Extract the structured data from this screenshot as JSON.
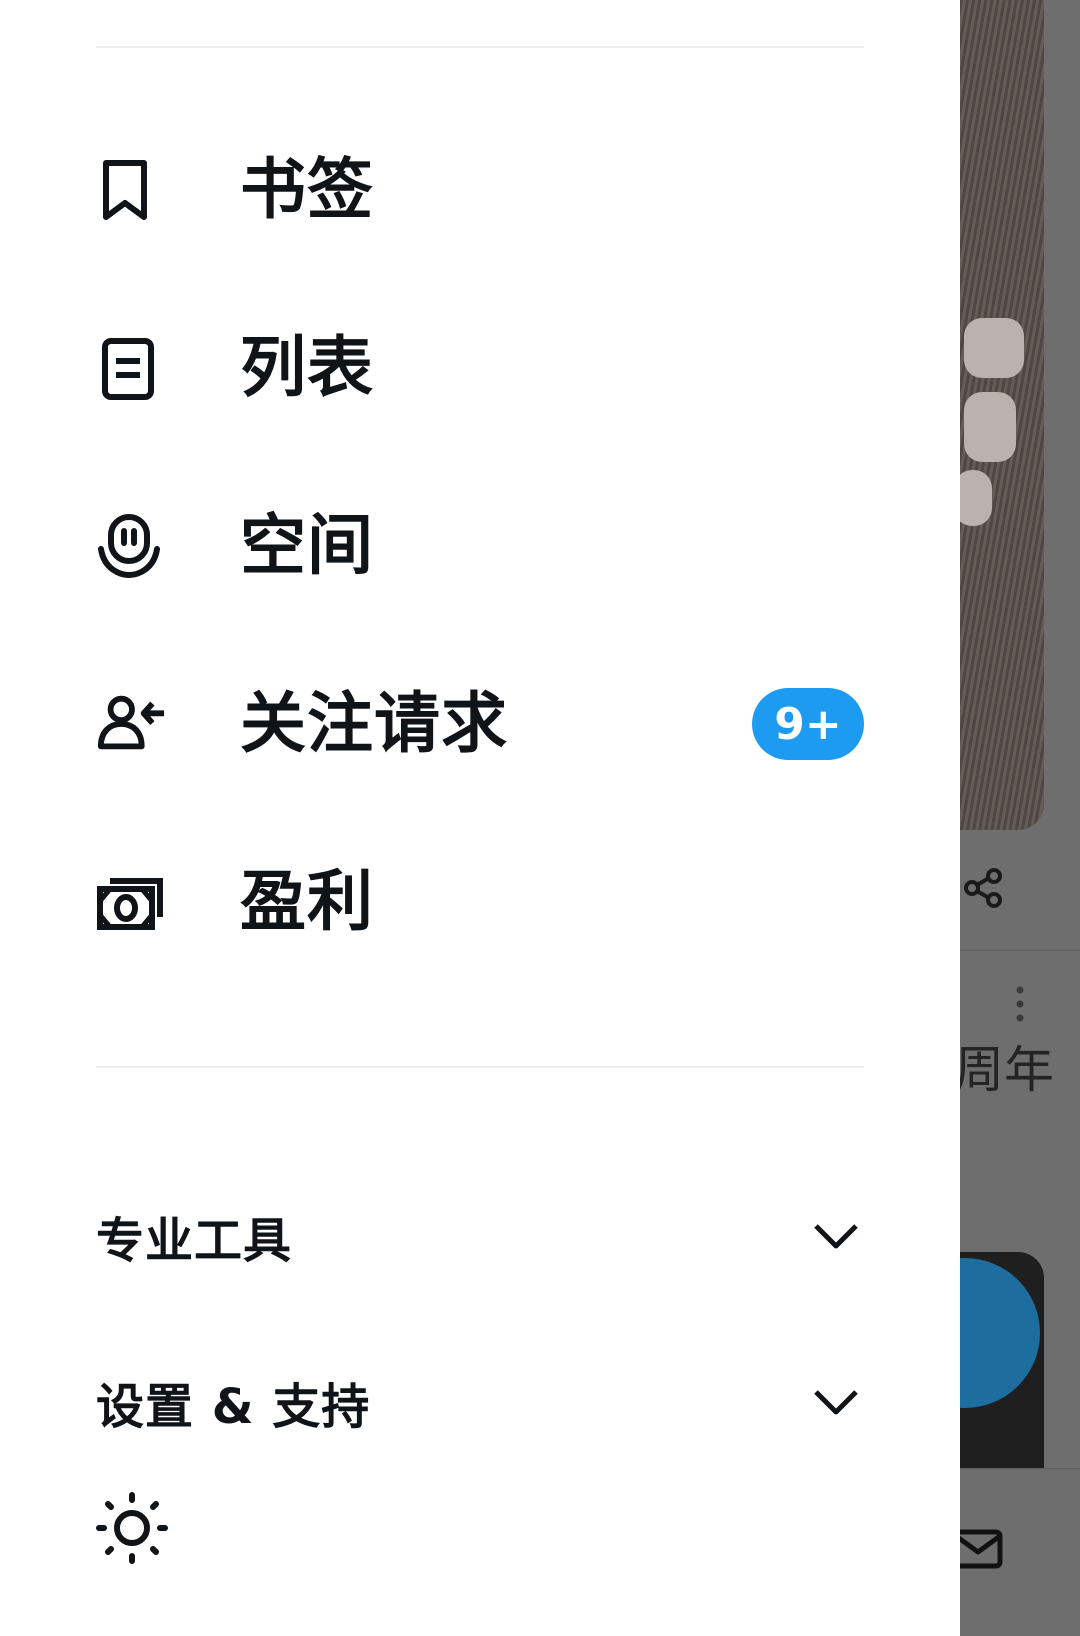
{
  "drawer": {
    "nav_items": [
      {
        "label": "书签",
        "icon": "bookmark-icon"
      },
      {
        "label": "列表",
        "icon": "list-icon"
      },
      {
        "label": "空间",
        "icon": "spaces-icon"
      },
      {
        "label": "关注请求",
        "icon": "follow-request-icon",
        "badge": "9+"
      },
      {
        "label": "盈利",
        "icon": "monetization-icon"
      }
    ],
    "sections": [
      {
        "label": "专业工具",
        "icon": "chevron-down-icon"
      },
      {
        "label": "设置 & 支持",
        "icon": "chevron-down-icon"
      }
    ],
    "theme_icon": "sun-icon"
  },
  "background": {
    "partial_text": "周年"
  },
  "colors": {
    "badge": "#1d9bf0",
    "text": "#0f1419",
    "divider": "#eceef0",
    "overlay": "#6b6b6b"
  }
}
